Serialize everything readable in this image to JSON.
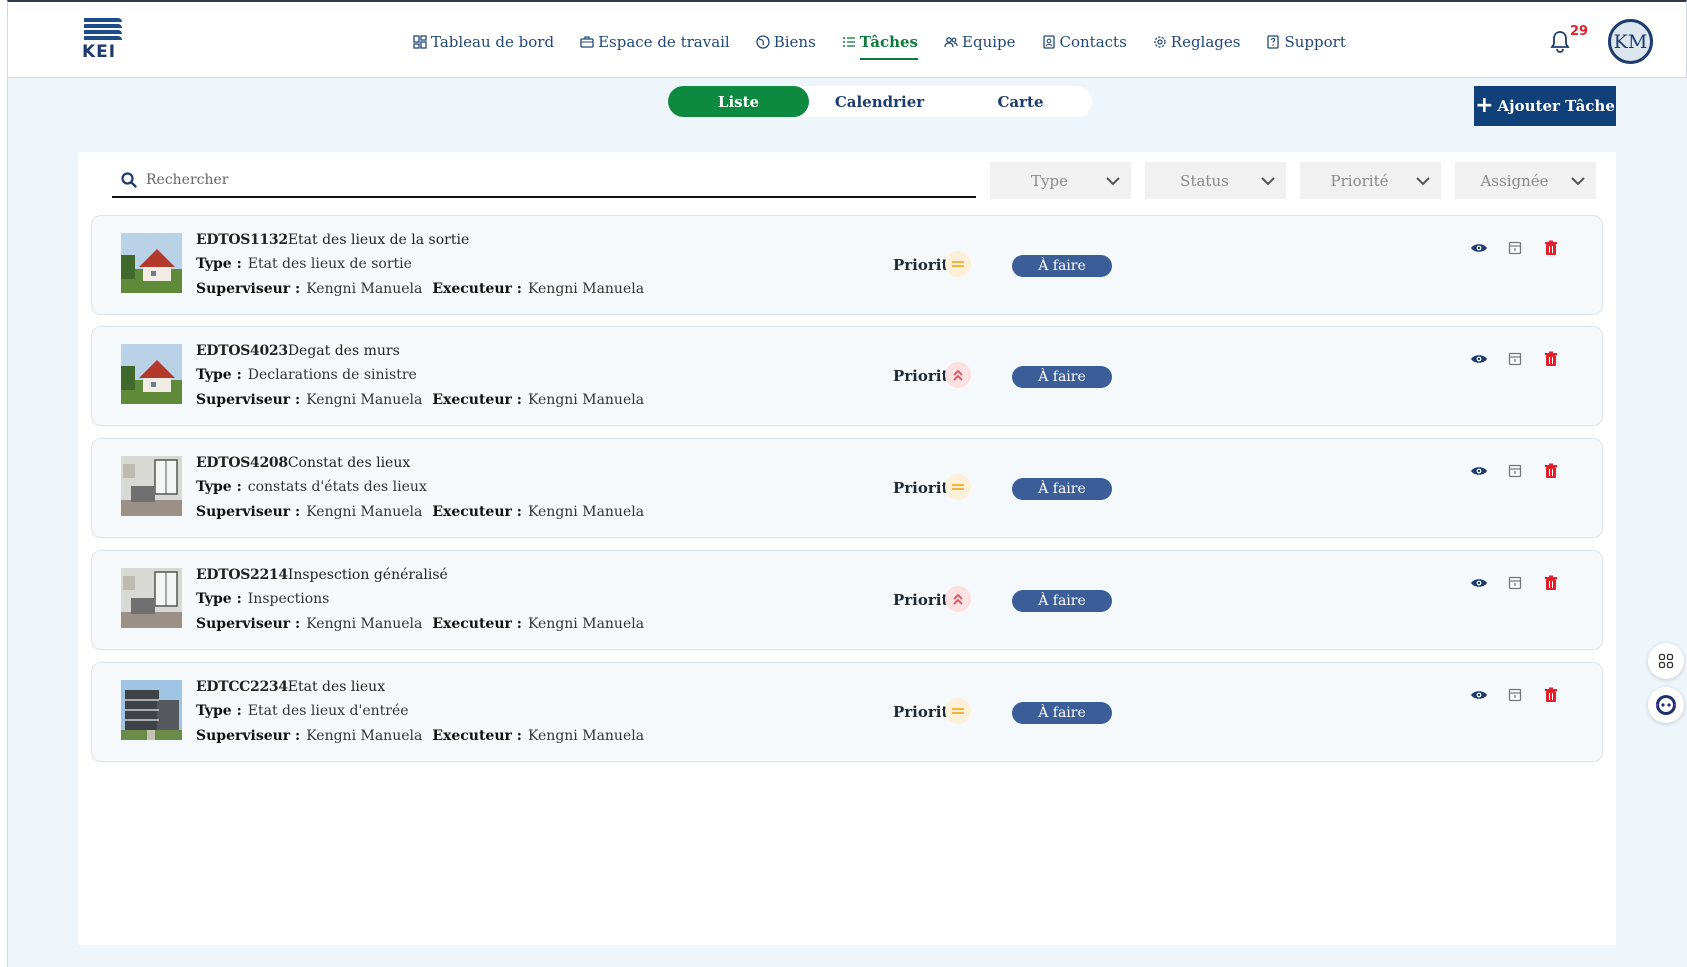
{
  "brand": {
    "logo_text": "KEI"
  },
  "nav": [
    {
      "label": "Tableau de bord",
      "icon": "dashboard-icon",
      "active": false
    },
    {
      "label": "Espace de travail",
      "icon": "briefcase-icon",
      "active": false
    },
    {
      "label": "Biens",
      "icon": "globe-icon",
      "active": false
    },
    {
      "label": "Tâches",
      "icon": "list-icon",
      "active": true
    },
    {
      "label": "Equipe",
      "icon": "team-icon",
      "active": false
    },
    {
      "label": "Contacts",
      "icon": "contacts-icon",
      "active": false
    },
    {
      "label": "Reglages",
      "icon": "gear-icon",
      "active": false
    },
    {
      "label": "Support",
      "icon": "support-icon",
      "active": false
    }
  ],
  "notifications": {
    "count": "29"
  },
  "user": {
    "initials": "KM"
  },
  "view_tabs": [
    {
      "label": "Liste",
      "active": true
    },
    {
      "label": "Calendrier",
      "active": false
    },
    {
      "label": "Carte",
      "active": false
    }
  ],
  "add_button": {
    "label": "Ajouter Tâche"
  },
  "search": {
    "placeholder": "Rechercher"
  },
  "filters": [
    {
      "label": "Type"
    },
    {
      "label": "Status"
    },
    {
      "label": "Priorité"
    },
    {
      "label": "Assignée"
    }
  ],
  "field_labels": {
    "type": "Type :",
    "supervisor": "Superviseur :",
    "executor": "Executeur :",
    "priority": "Priorité"
  },
  "tasks": [
    {
      "code": "EDTOS1132",
      "title": "Etat des lieux de la sortie",
      "type": "Etat des lieux de sortie",
      "supervisor": "Kengni Manuela",
      "executor": "Kengni Manuela",
      "priority": "medium",
      "status": "À faire",
      "thumb": "house"
    },
    {
      "code": "EDTOS4023",
      "title": "Degat des murs",
      "type": "Declarations de sinistre",
      "supervisor": "Kengni Manuela",
      "executor": "Kengni Manuela",
      "priority": "high",
      "status": "À faire",
      "thumb": "house"
    },
    {
      "code": "EDTOS4208",
      "title": "Constat des lieux",
      "type": "constats d'états des lieux",
      "supervisor": "Kengni Manuela",
      "executor": "Kengni Manuela",
      "priority": "medium",
      "status": "À faire",
      "thumb": "interior"
    },
    {
      "code": "EDTOS2214",
      "title": "Inspesction généralisé",
      "type": "Inspections",
      "supervisor": "Kengni Manuela",
      "executor": "Kengni Manuela",
      "priority": "high",
      "status": "À faire",
      "thumb": "interior"
    },
    {
      "code": "EDTCC2234",
      "title": "Etat des lieux",
      "type": "Etat des lieux d'entrée",
      "supervisor": "Kengni Manuela",
      "executor": "Kengni Manuela",
      "priority": "medium",
      "status": "À faire",
      "thumb": "building"
    }
  ],
  "colors": {
    "primary_green": "#0d8a40",
    "navy": "#10407a",
    "status_blue": "#3c5e98",
    "priority_high": "#e0505a",
    "priority_medium": "#f2b53a",
    "delete_red": "#e0202a"
  }
}
